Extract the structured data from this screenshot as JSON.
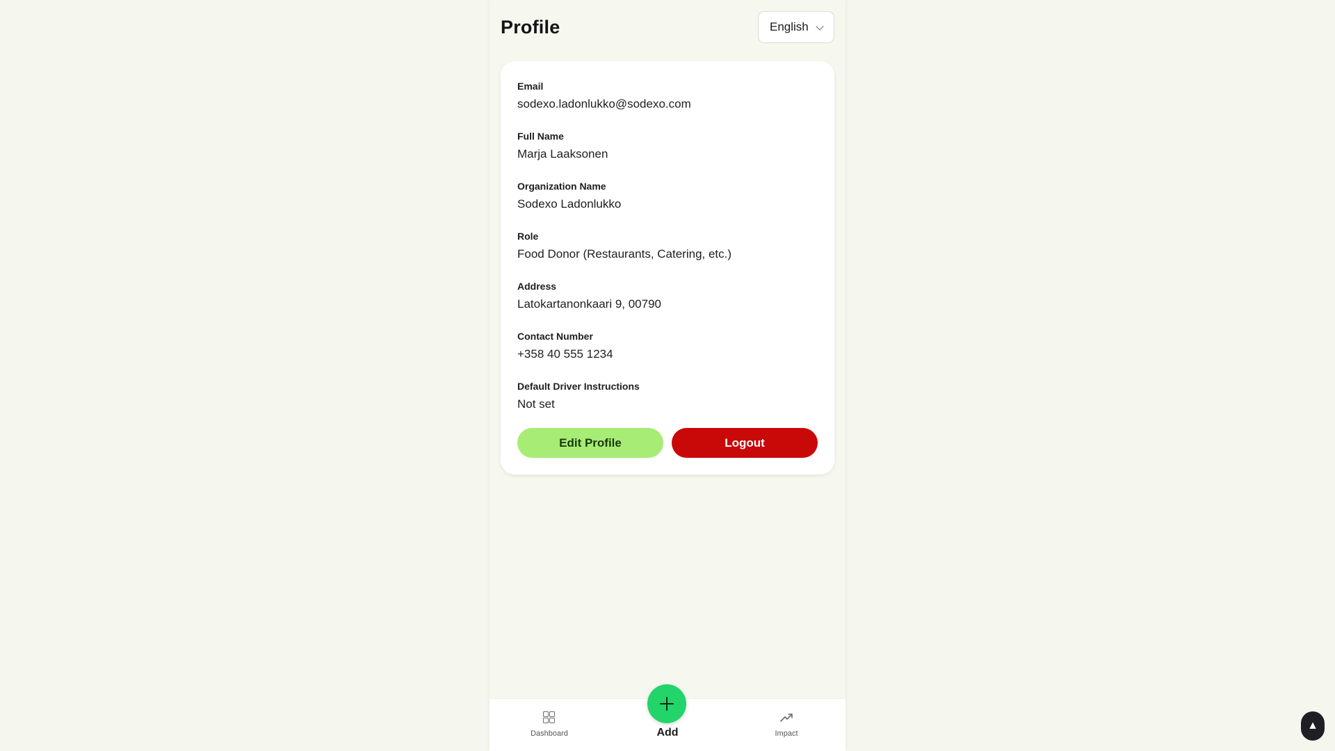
{
  "header": {
    "title": "Profile",
    "language": "English"
  },
  "profile": {
    "fields": [
      {
        "label": "Email",
        "value": "sodexo.ladonlukko@sodexo.com"
      },
      {
        "label": "Full Name",
        "value": "Marja Laaksonen"
      },
      {
        "label": "Organization Name",
        "value": "Sodexo Ladonlukko"
      },
      {
        "label": "Role",
        "value": "Food Donor (Restaurants, Catering, etc.)"
      },
      {
        "label": "Address",
        "value": "Latokartanonkaari 9, 00790"
      },
      {
        "label": "Contact Number",
        "value": "+358 40 555 1234"
      },
      {
        "label": "Default Driver Instructions",
        "value": "Not set"
      }
    ],
    "edit_label": "Edit Profile",
    "logout_label": "Logout"
  },
  "nav": {
    "dashboard_label": "Dashboard",
    "add_label": "Add",
    "impact_label": "Impact"
  },
  "scroll_top_glyph": "▲",
  "colors": {
    "background": "#f5f7ef",
    "edit_button": "#a6ec75",
    "logout_button": "#c90808",
    "add_button": "#22d46a"
  }
}
